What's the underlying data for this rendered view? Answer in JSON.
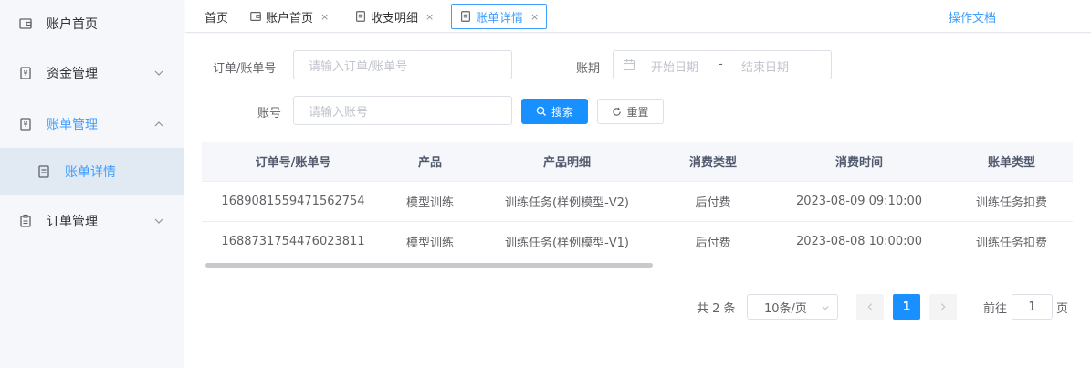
{
  "sidebar": {
    "items": [
      {
        "label": "账户首页"
      },
      {
        "label": "资金管理"
      },
      {
        "label": "账单管理"
      },
      {
        "label": "账单详情"
      },
      {
        "label": "订单管理"
      }
    ]
  },
  "tabs": [
    {
      "label": "首页"
    },
    {
      "label": "账户首页",
      "close": "×"
    },
    {
      "label": "收支明细",
      "close": "×"
    },
    {
      "label": "账单详情",
      "close": "×"
    }
  ],
  "doc_link": "操作文档",
  "search": {
    "order_label": "订单/账单号",
    "order_placeholder": "请输入订单/账单号",
    "period_label": "账期",
    "start_placeholder": "开始日期",
    "range_sep": "-",
    "end_placeholder": "结束日期",
    "account_label": "账号",
    "account_placeholder": "请输入账号",
    "search_btn": "搜索",
    "reset_btn": "重置"
  },
  "table": {
    "headers": [
      "订单号/账单号",
      "产品",
      "产品明细",
      "消费类型",
      "消费时间",
      "账单类型"
    ],
    "rows": [
      [
        "1689081559471562754",
        "模型训练",
        "训练任务(样例模型-V2)",
        "后付费",
        "2023-08-09 09:10:00",
        "训练任务扣费"
      ],
      [
        "1688731754476023811",
        "模型训练",
        "训练任务(样例模型-V1)",
        "后付费",
        "2023-08-08 10:00:00",
        "训练任务扣费"
      ]
    ]
  },
  "pagination": {
    "total": "共 2 条",
    "page_size": "10条/页",
    "current": "1",
    "goto_label": "前往",
    "goto_value": "1",
    "page_suffix": "页"
  },
  "colors": {
    "accent": "#409eff",
    "primary_button": "#1890ff"
  }
}
